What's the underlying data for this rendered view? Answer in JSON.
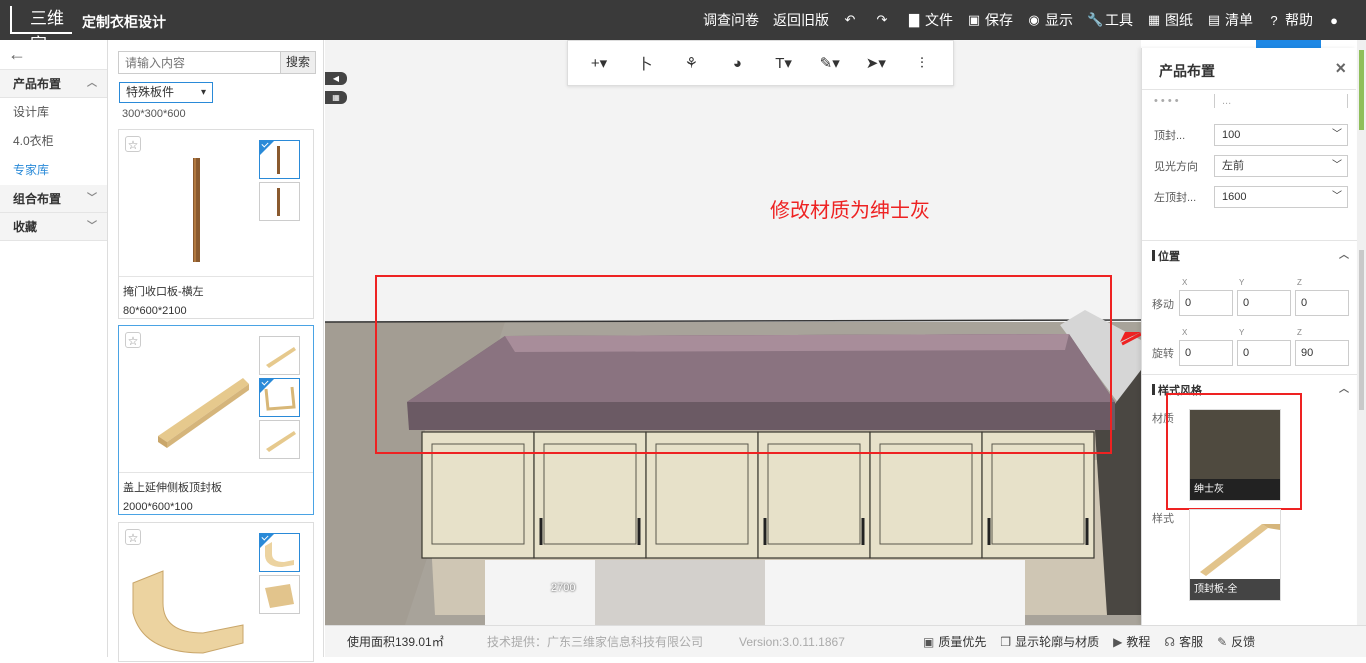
{
  "header": {
    "logo": "三维家",
    "title": "定制衣柜设计",
    "menu": [
      {
        "label": "调查问卷",
        "icon": ""
      },
      {
        "label": "返回旧版",
        "icon": ""
      },
      {
        "label": "",
        "icon": "↶"
      },
      {
        "label": "",
        "icon": "↷"
      },
      {
        "label": "文件",
        "icon": "▇"
      },
      {
        "label": "保存",
        "icon": "▣"
      },
      {
        "label": "显示",
        "icon": "◉"
      },
      {
        "label": "工具",
        "icon": "🔧"
      },
      {
        "label": "图纸",
        "icon": "▦"
      },
      {
        "label": "清单",
        "icon": "▤"
      },
      {
        "label": "帮助",
        "icon": "?"
      },
      {
        "label": "",
        "icon": "●"
      }
    ]
  },
  "leftnav": {
    "back": "←",
    "sections": [
      {
        "title": "产品布置",
        "chev": "︿",
        "items": [
          "设计库",
          "4.0衣柜",
          "专家库"
        ],
        "active": 2
      },
      {
        "title": "组合布置",
        "chev": "﹀",
        "items": []
      },
      {
        "title": "收藏",
        "chev": "﹀",
        "items": []
      }
    ]
  },
  "catalog": {
    "search_placeholder": "请输入内容",
    "search_btn": "搜索",
    "filter": "特殊板件",
    "caret": "▾",
    "cut_label": "300*300*600",
    "cards": [
      {
        "name": "掩门收口板-横左",
        "size": "80*600*2100"
      },
      {
        "name": "盖上延伸侧板顶封板",
        "size": "2000*600*100"
      },
      {
        "name": "",
        "size": ""
      }
    ]
  },
  "canvas": {
    "toolbar": [
      "+▾",
      "卜",
      "⚘",
      "◕",
      "T▾",
      "✎▾",
      "➤▾",
      "⫶"
    ],
    "annotation": "修改材质为绅士灰",
    "dimension": "2700",
    "side_btns": [
      "◀",
      "▦"
    ]
  },
  "rightpanel": {
    "title": "产品布置",
    "close": "×",
    "props": [
      {
        "label": "顶封...",
        "value": "100"
      },
      {
        "label": "见光方向",
        "value": "左前"
      },
      {
        "label": "左顶封...",
        "value": "1600"
      }
    ],
    "position_title": "位置",
    "move_label": "移动",
    "rotate_label": "旋转",
    "axes": [
      "X",
      "Y",
      "Z"
    ],
    "move": [
      "0",
      "0",
      "0"
    ],
    "rotate": [
      "0",
      "0",
      "90"
    ],
    "style_title": "样式风格",
    "material_label": "材质",
    "material": "绅士灰",
    "material_color": "#4f4a3f",
    "style_label": "样式",
    "style": "顶封板-全",
    "chev": "︿"
  },
  "bottombar": {
    "area": "使用面积139.01㎡",
    "provider": "技术提供：广东三维家信息科技有限公司",
    "version": "Version:3.0.11.1867",
    "items": [
      {
        "icon": "▣",
        "label": "质量优先"
      },
      {
        "icon": "❒",
        "label": "显示轮廓与材质"
      },
      {
        "icon": "▶",
        "label": "教程"
      },
      {
        "icon": "☊",
        "label": "客服"
      },
      {
        "icon": "✎",
        "label": "反馈"
      }
    ]
  }
}
